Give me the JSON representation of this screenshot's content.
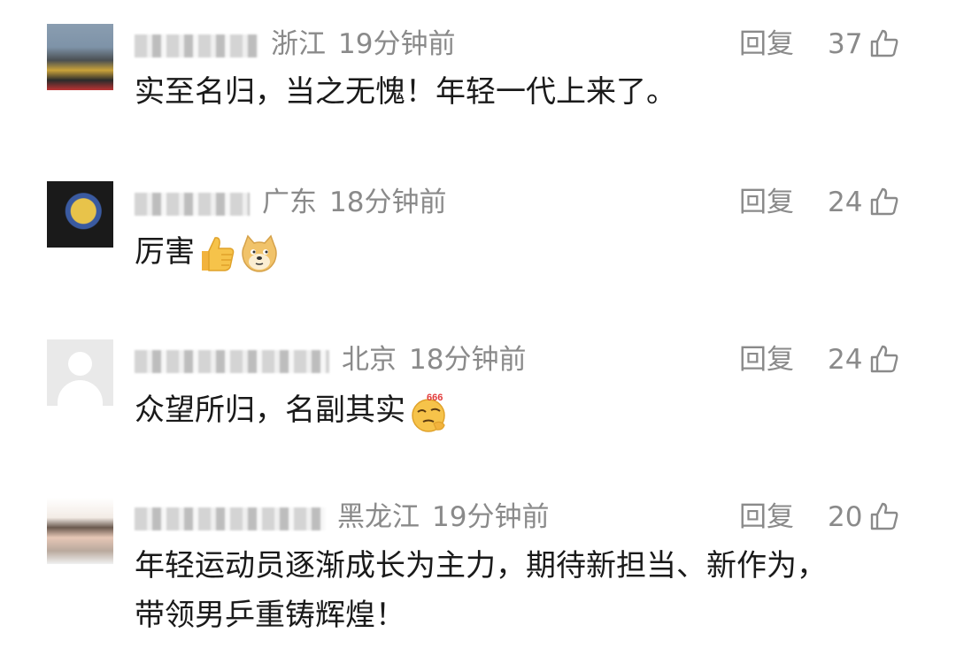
{
  "comments": [
    {
      "location": "浙江",
      "time": "19分钟前",
      "reply_label": "回复",
      "likes": "37",
      "text": "实至名归，当之无愧！年轻一代上来了。",
      "emojis": []
    },
    {
      "location": "广东",
      "time": "18分钟前",
      "reply_label": "回复",
      "likes": "24",
      "text": "厉害",
      "emojis": [
        "thumbs-up",
        "doge"
      ]
    },
    {
      "location": "北京",
      "time": "18分钟前",
      "reply_label": "回复",
      "likes": "24",
      "text": "众望所归，名副其实",
      "emojis": [
        "666-thinking"
      ]
    },
    {
      "location": "黑龙江",
      "time": "19分钟前",
      "reply_label": "回复",
      "likes": "20",
      "text_line1": "年轻运动员逐渐成长为主力，期待新担当、新作为，",
      "text_line2": "带领男乒重铸辉煌！",
      "emojis": []
    }
  ],
  "colors": {
    "meta_gray": "#8a8a8a",
    "text_black": "#1a1a1a"
  }
}
